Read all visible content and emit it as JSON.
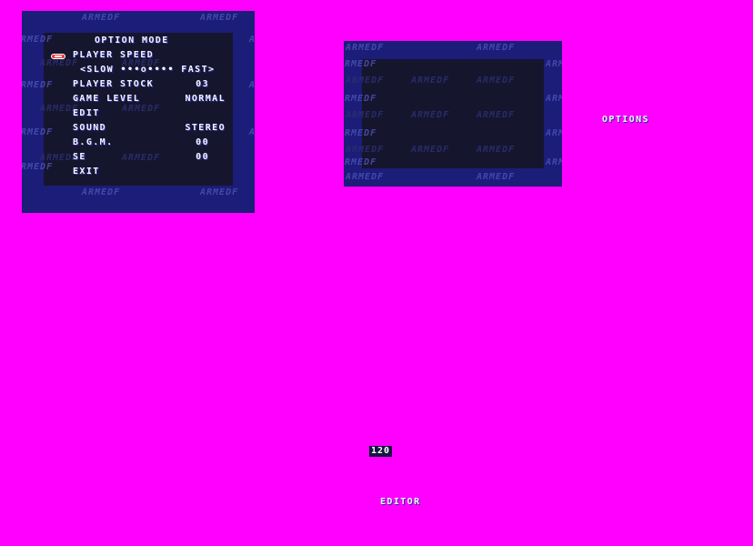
{
  "colors": {
    "background": "#ff00ff",
    "panel_border": "#1b1d78",
    "panel_inner": "#15152e",
    "text": "#f4f4ff",
    "cursor": "#e03a3a"
  },
  "watermark_text": "ARMEDF",
  "option_menu": {
    "title": "OPTION MODE",
    "cursor_icon": "ship-cursor-icon",
    "rows": [
      {
        "label": "PLAYER SPEED",
        "value": ""
      },
      {
        "label": "PLAYER STOCK",
        "value": "03"
      },
      {
        "label": "GAME LEVEL",
        "value": "NORMAL"
      },
      {
        "label": "EDIT",
        "value": ""
      },
      {
        "label": "SOUND",
        "value": "STEREO"
      },
      {
        "label": "B.G.M.",
        "value": "00"
      },
      {
        "label": "SE",
        "value": "00"
      },
      {
        "label": "EXIT",
        "value": ""
      }
    ],
    "speed_line": "<SLOW •••o•••• FAST>",
    "speed_level": 4,
    "speed_max": 8
  },
  "labels": {
    "options": "OPTIONS",
    "editor": "EDITOR",
    "counter": "120"
  }
}
